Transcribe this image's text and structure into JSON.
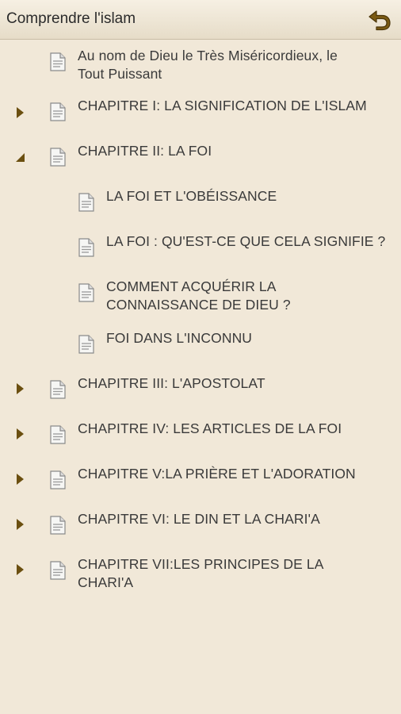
{
  "header": {
    "title": "Comprendre l'islam",
    "back_icon": "undo-arrow-icon",
    "accent_color": "#7a5a13"
  },
  "toc": {
    "items": [
      {
        "label": "Au nom de Dieu le Très Miséricordieux, le\nTout Puissant",
        "level": 0,
        "expander": "none"
      },
      {
        "label": "CHAPITRE I: LA SIGNIFICATION DE L'ISLAM",
        "level": 0,
        "expander": "collapsed"
      },
      {
        "label": "CHAPITRE II: LA FOI",
        "level": 0,
        "expander": "expanded"
      },
      {
        "label": "LA FOI ET L'OBÉISSANCE",
        "level": 1,
        "expander": "none"
      },
      {
        "label": "LA FOI : QU'EST-CE QUE CELA SIGNIFIE ?",
        "level": 1,
        "expander": "none"
      },
      {
        "label": "COMMENT ACQUÉRIR LA\nCONNAISSANCE DE DIEU ?",
        "level": 1,
        "expander": "none"
      },
      {
        "label": "FOI DANS L'INCONNU",
        "level": 1,
        "expander": "none"
      },
      {
        "label": "CHAPITRE III: L'APOSTOLAT",
        "level": 0,
        "expander": "collapsed"
      },
      {
        "label": "CHAPITRE IV: LES ARTICLES DE LA FOI",
        "level": 0,
        "expander": "collapsed"
      },
      {
        "label": "CHAPITRE V:LA PRIÈRE ET L'ADORATION",
        "level": 0,
        "expander": "collapsed"
      },
      {
        "label": "CHAPITRE VI: LE DIN ET LA CHARI'A",
        "level": 0,
        "expander": "collapsed"
      },
      {
        "label": "CHAPITRE VII:LES PRINCIPES DE LA\nCHARI'A",
        "level": 0,
        "expander": "collapsed"
      }
    ]
  }
}
